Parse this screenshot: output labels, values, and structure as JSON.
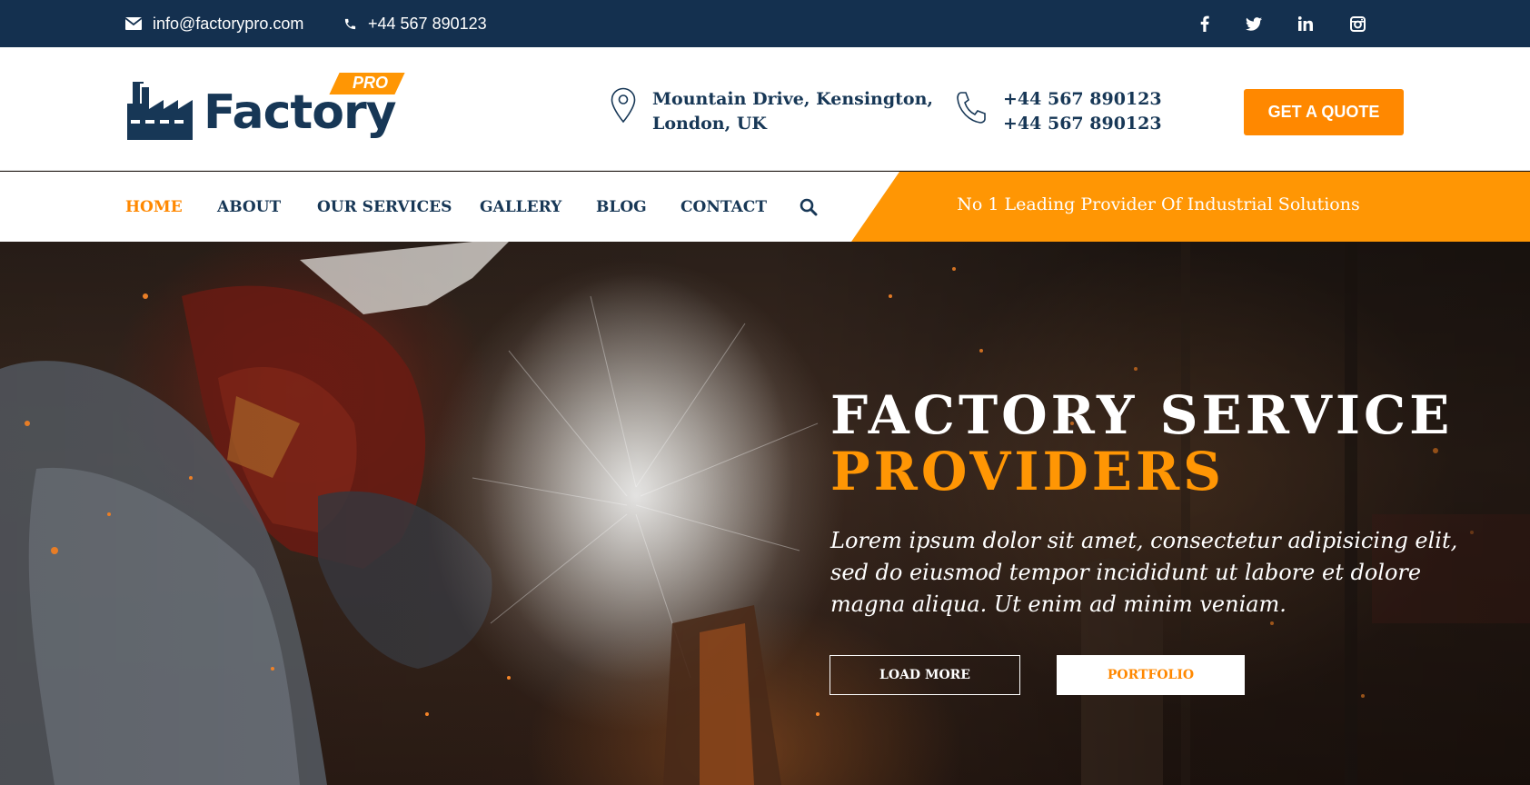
{
  "topbar": {
    "email": "info@factorypro.com",
    "phone": "+44 567 890123",
    "social": [
      "facebook-icon",
      "twitter-icon",
      "linkedin-icon",
      "instagram-icon"
    ]
  },
  "header": {
    "logo_text": "Factory",
    "logo_badge": "PRO",
    "address_line1": "Mountain Drive, Kensington,",
    "address_line2": "London, UK",
    "phone_line1": "+44 567 890123",
    "phone_line2": "+44 567 890123",
    "quote_button": "GET A QUOTE"
  },
  "nav": {
    "items": [
      {
        "label": "HOME",
        "active": true
      },
      {
        "label": "ABOUT",
        "active": false
      },
      {
        "label": "OUR SERVICES",
        "active": false
      },
      {
        "label": "GALLERY",
        "active": false
      },
      {
        "label": "BLOG",
        "active": false
      },
      {
        "label": "CONTACT",
        "active": false
      }
    ],
    "tagline": "No 1 Leading Provider Of Industrial Solutions"
  },
  "hero": {
    "title_line1": "FACTORY SERVICE",
    "title_line2": "PROVIDERS",
    "description": "Lorem ipsum dolor sit amet, consectetur adipisicing elit, sed do eiusmod tempor incididunt ut labore et dolore magna aliqua. Ut enim ad minim veniam.",
    "button_primary": "LOAD MORE",
    "button_secondary": "PORTFOLIO"
  },
  "colors": {
    "navy": "#14304f",
    "brand_text": "#173756",
    "accent_orange": "#ff9604",
    "button_orange": "#ff8800"
  }
}
